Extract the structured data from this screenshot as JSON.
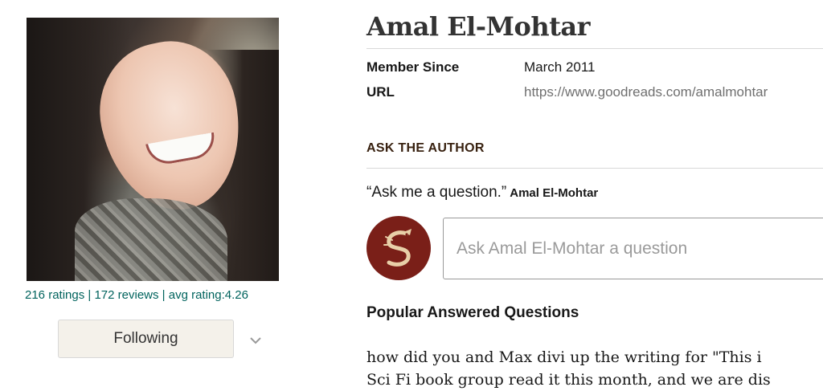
{
  "author": {
    "name": "Amal El-Mohtar",
    "stats": {
      "ratings": "216 ratings",
      "reviews": "172 reviews",
      "avg_rating": "avg rating:4.26",
      "separator": " | "
    },
    "follow_button_label": "Following",
    "details": [
      {
        "label": "Member Since",
        "value": "March 2011"
      },
      {
        "label": "URL",
        "value": "https://www.goodreads.com/amalmohtar"
      }
    ]
  },
  "ask_section": {
    "title": "ASK THE AUTHOR",
    "quote": "“Ask me a question.”",
    "quote_author": "Amal El-Mohtar",
    "input_placeholder": "Ask Amal El-Mohtar a question"
  },
  "popular_questions": {
    "title": "Popular Answered Questions",
    "items": [
      "how did you and Max divi up the writing for \"This i",
      "Sci Fi book group read it this month, and we are dis"
    ]
  },
  "colors": {
    "link": "#00635d",
    "section_title": "#382110",
    "button_bg": "#f4f1ea",
    "avatar_bg": "#7a1f18"
  },
  "icons": {
    "dropdown": "chevron-down-icon",
    "avatar": "dragon-s-logo-icon"
  }
}
